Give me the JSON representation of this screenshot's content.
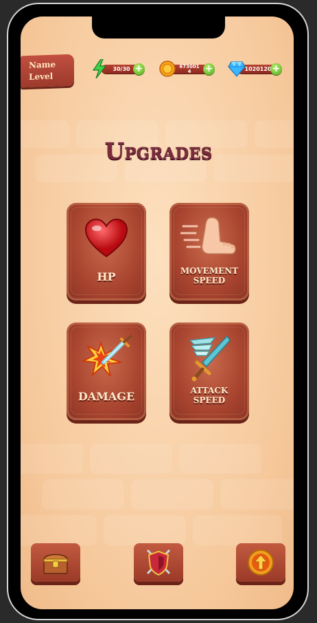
{
  "player": {
    "name_label": "Name",
    "level_label": "Level"
  },
  "resources": {
    "energy": {
      "value": "30/30",
      "icon": "lightning-icon",
      "color": "#3fd14a"
    },
    "gold": {
      "value_line1": "673001",
      "value_line2": "4",
      "icon": "coin-icon",
      "color": "#f6a21a"
    },
    "gems": {
      "value": "1020120",
      "icon": "diamond-icon",
      "color": "#38b6ff"
    },
    "plus_label": "+"
  },
  "screen_title": "Upgrades",
  "upgrades": [
    {
      "label": "HP",
      "icon": "heart-icon"
    },
    {
      "label": "MOVEMENT SPEED",
      "line1": "MOVEMENT",
      "line2": "SPEED",
      "icon": "foot-icon"
    },
    {
      "label": "DAMAGE",
      "icon": "sword-hit-icon"
    },
    {
      "label": "ATTACK SPEED",
      "line1": "ATTACK",
      "line2": "SPEED",
      "icon": "winged-sword-icon"
    }
  ],
  "nav": [
    {
      "icon": "chest-icon"
    },
    {
      "icon": "shield-swords-icon"
    },
    {
      "icon": "upgrade-arrow-icon"
    }
  ],
  "colors": {
    "background": "#f6c99c",
    "card": "#a8442f",
    "title": "#7a2c3c"
  }
}
